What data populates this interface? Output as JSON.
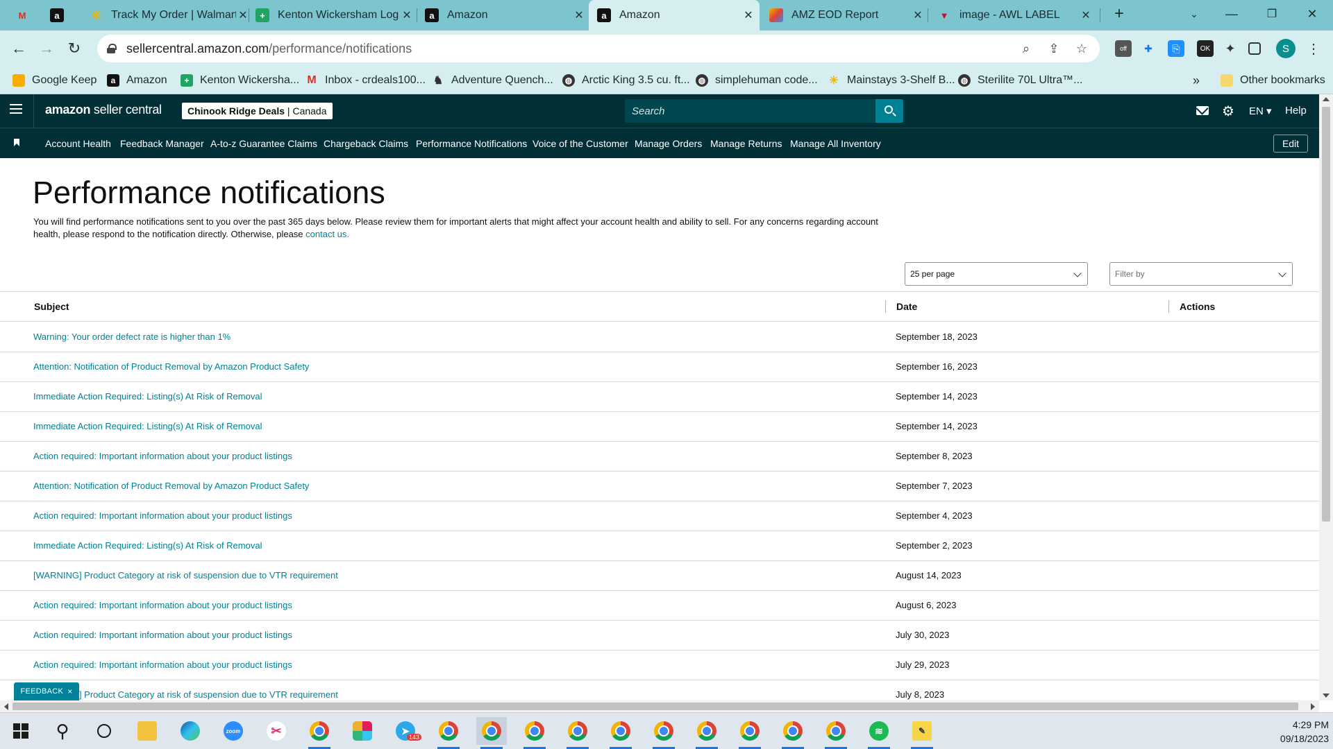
{
  "browser": {
    "tabs": [
      {
        "title": "",
        "icon": "gmail-icon"
      },
      {
        "title": "",
        "icon": "amazon-icon"
      },
      {
        "title": "Track My Order | Walmart",
        "icon": "walmart-icon"
      },
      {
        "title": "Kenton Wickersham Log",
        "icon": "sheets-icon"
      },
      {
        "title": "Amazon",
        "icon": "amazon-icon"
      },
      {
        "title": "Amazon",
        "icon": "amazon-icon",
        "active": true
      },
      {
        "title": "AMZ EOD Report",
        "icon": "app-icon"
      },
      {
        "title": "image - AWL LABEL",
        "icon": "awl-icon"
      }
    ],
    "url_host": "sellercentral.amazon.com",
    "url_path": "/performance/notifications",
    "bookmarks": [
      "Google Keep",
      "Amazon",
      "Kenton Wickersha...",
      "Inbox - crdeals100...",
      "Adventure Quench...",
      "Arctic King 3.5 cu. ft...",
      "simplehuman code...",
      "Mainstays 3-Shelf B...",
      "Sterilite 70L Ultra™..."
    ],
    "other_bookmarks": "Other bookmarks",
    "overflow": "»"
  },
  "header": {
    "logo_bold": "amazon",
    "logo_rest": " seller central",
    "store_name": "Chinook Ridge Deals",
    "store_region": "Canada",
    "search_placeholder": "Search",
    "language": "EN",
    "help": "Help"
  },
  "nav": {
    "items": [
      "Account Health",
      "Feedback Manager",
      "A-to-z Guarantee Claims",
      "Chargeback Claims",
      "Performance Notifications",
      "Voice of the Customer",
      "Manage Orders",
      "Manage Returns",
      "Manage All Inventory"
    ],
    "edit": "Edit"
  },
  "page": {
    "title": "Performance notifications",
    "intro": "You will find performance notifications sent to you over the past 365 days below. Please review them for important alerts that might affect your account health and ability to sell. For any concerns regarding account health, please respond to the notification directly. Otherwise, please ",
    "contact_link": "contact us.",
    "per_page": "25 per page",
    "filter_placeholder": "Filter by"
  },
  "table": {
    "columns": [
      "Subject",
      "Date",
      "Actions"
    ],
    "rows": [
      {
        "subject": "Warning: Your order defect rate is higher than 1%",
        "date": "September 18, 2023"
      },
      {
        "subject": "Attention: Notification of Product Removal by Amazon Product Safety",
        "date": "September 16, 2023"
      },
      {
        "subject": "Immediate Action Required: Listing(s) At Risk of Removal",
        "date": "September 14, 2023"
      },
      {
        "subject": "Immediate Action Required: Listing(s) At Risk of Removal",
        "date": "September 14, 2023"
      },
      {
        "subject": "Action required: Important information about your product listings",
        "date": "September 8, 2023"
      },
      {
        "subject": "Attention: Notification of Product Removal by Amazon Product Safety",
        "date": "September 7, 2023"
      },
      {
        "subject": "Action required: Important information about your product listings",
        "date": "September 4, 2023"
      },
      {
        "subject": "Immediate Action Required: Listing(s) At Risk of Removal",
        "date": "September 2, 2023"
      },
      {
        "subject": "[WARNING] Product Category at risk of suspension due to VTR requirement",
        "date": "August 14, 2023"
      },
      {
        "subject": "Action required: Important information about your product listings",
        "date": "August 6, 2023"
      },
      {
        "subject": "Action required: Important information about your product listings",
        "date": "July 30, 2023"
      },
      {
        "subject": "Action required: Important information about your product listings",
        "date": "July 29, 2023"
      },
      {
        "subject": "[WARNING] Product Category at risk of suspension due to VTR requirement",
        "date": "July 8, 2023"
      }
    ]
  },
  "feedback": {
    "label": "FEEDBACK",
    "close": "×"
  },
  "taskbar": {
    "telegram_badge": "143",
    "time": "4:29 PM",
    "date": "09/18/2023"
  },
  "colors": {
    "header_bg": "#002f36",
    "link": "#008296",
    "tabbar": "#7cc5cf"
  }
}
